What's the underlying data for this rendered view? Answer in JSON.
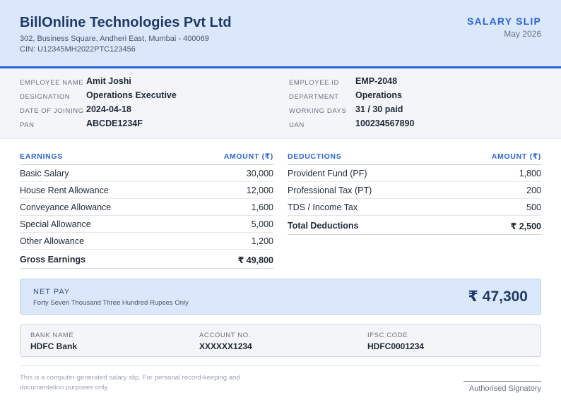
{
  "header": {
    "company_name": "BillOnline Technologies Pvt Ltd",
    "address": "302, Business Square, Andheri East, Mumbai - 400069",
    "cin": "CIN: U12345MH2022PTC123456",
    "slip_title": "SALARY SLIP",
    "period": "May 2026"
  },
  "employee": {
    "left": [
      {
        "label": "EMPLOYEE NAME",
        "value": "Amit Joshi"
      },
      {
        "label": "DESIGNATION",
        "value": "Operations Executive"
      },
      {
        "label": "DATE OF JOINING",
        "value": "2024-04-18"
      },
      {
        "label": "PAN",
        "value": "ABCDE1234F"
      }
    ],
    "right": [
      {
        "label": "EMPLOYEE ID",
        "value": "EMP-2048"
      },
      {
        "label": "DEPARTMENT",
        "value": "Operations"
      },
      {
        "label": "WORKING DAYS",
        "value": "31 / 30 paid"
      },
      {
        "label": "UAN",
        "value": "100234567890"
      }
    ]
  },
  "earnings": {
    "title": "EARNINGS",
    "amount_header": "AMOUNT (₹)",
    "rows": [
      {
        "name": "Basic Salary",
        "amount": "30,000"
      },
      {
        "name": "House Rent Allowance",
        "amount": "12,000"
      },
      {
        "name": "Conveyance Allowance",
        "amount": "1,600"
      },
      {
        "name": "Special Allowance",
        "amount": "5,000"
      },
      {
        "name": "Other Allowance",
        "amount": "1,200"
      }
    ],
    "total_label": "Gross Earnings",
    "total_amount": "₹ 49,800"
  },
  "deductions": {
    "title": "DEDUCTIONS",
    "amount_header": "AMOUNT (₹)",
    "rows": [
      {
        "name": "Provident Fund (PF)",
        "amount": "1,800"
      },
      {
        "name": "Professional Tax (PT)",
        "amount": "200"
      },
      {
        "name": "TDS / Income Tax",
        "amount": "500"
      }
    ],
    "total_label": "Total Deductions",
    "total_amount": "₹ 2,500"
  },
  "net_pay": {
    "label": "NET PAY",
    "words": "Forty Seven Thousand Three Hundred Rupees Only",
    "amount": "₹ 47,300"
  },
  "bank": [
    {
      "label": "BANK NAME",
      "value": "HDFC Bank"
    },
    {
      "label": "ACCOUNT NO.",
      "value": "XXXXXX1234"
    },
    {
      "label": "IFSC CODE",
      "value": "HDFC0001234"
    }
  ],
  "footer": {
    "note": "This is a computer-generated salary slip. For personal record-keeping and documentation purposes only.",
    "signatory": "Authorised Signatory"
  }
}
